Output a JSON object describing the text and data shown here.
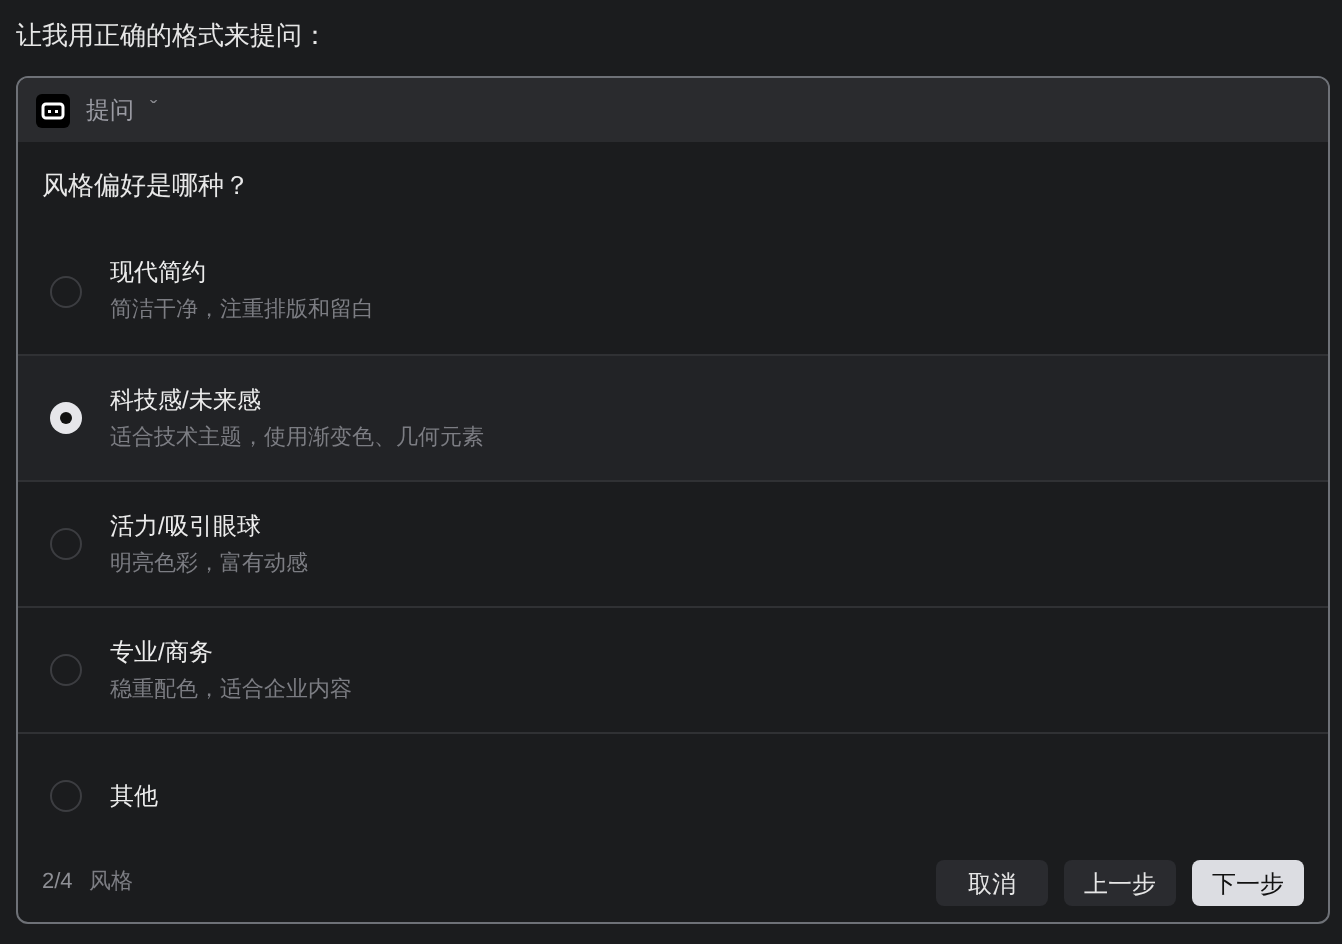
{
  "intro": "让我用正确的格式来提问：",
  "header": {
    "title": "提问",
    "caret": "ˇ"
  },
  "question": "风格偏好是哪种？",
  "options": [
    {
      "label": "现代简约",
      "description": "简洁干净，注重排版和留白",
      "selected": false
    },
    {
      "label": "科技感/未来感",
      "description": "适合技术主题，使用渐变色、几何元素",
      "selected": true
    },
    {
      "label": "活力/吸引眼球",
      "description": "明亮色彩，富有动感",
      "selected": false
    },
    {
      "label": "专业/商务",
      "description": "稳重配色，适合企业内容",
      "selected": false
    },
    {
      "label": "其他",
      "selected": false
    }
  ],
  "footer": {
    "step": "2/4",
    "step_name": "风格",
    "buttons": [
      {
        "label": "取消",
        "kind": "secondary"
      },
      {
        "label": "上一步",
        "kind": "secondary"
      },
      {
        "label": "下一步",
        "kind": "primary"
      }
    ]
  }
}
